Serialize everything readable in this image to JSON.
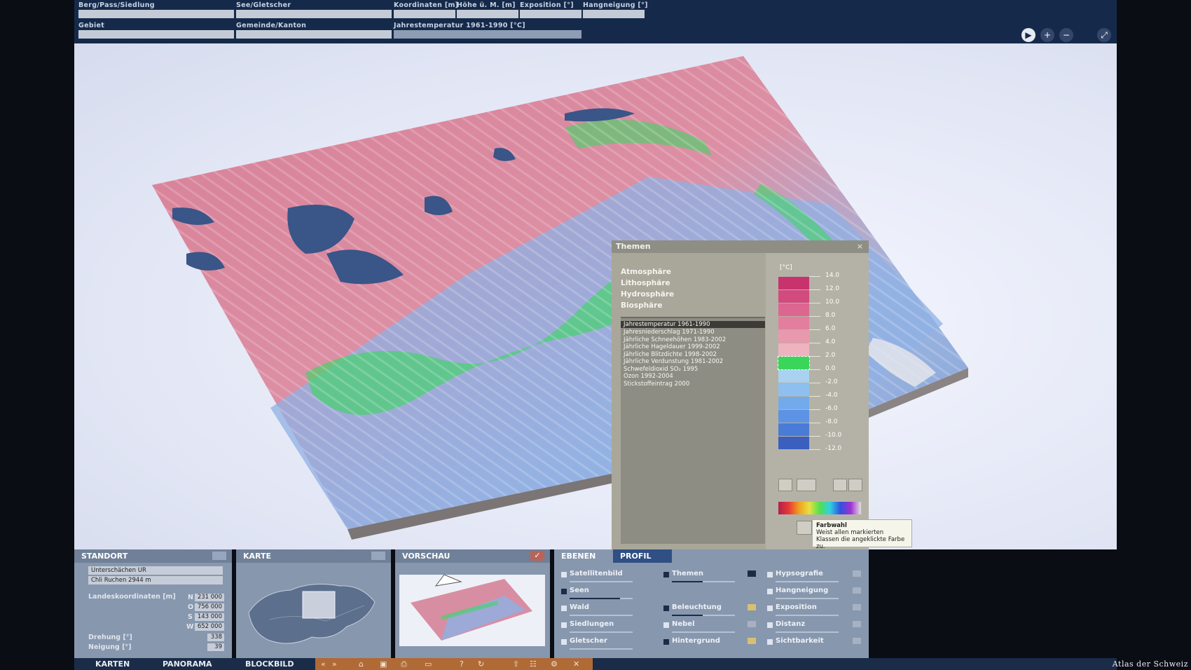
{
  "topbar": {
    "row1": [
      "Berg/Pass/Siedlung",
      "See/Gletscher",
      "Koordinaten [m]",
      "Höhe ü. M. [m]",
      "Exposition [°]",
      "Hangneigung [°]"
    ],
    "row2": [
      "Gebiet",
      "Gemeinde/Kanton",
      "Jahrestemperatur 1961-1990 [°C]"
    ],
    "controls": [
      "play-icon",
      "zoom-in-icon",
      "zoom-out-icon",
      "fullscreen-icon"
    ]
  },
  "themen": {
    "title": "Themen",
    "close": "×",
    "categories": [
      "Atmosphäre",
      "Lithosphäre",
      "Hydrosphäre",
      "Biosphäre"
    ],
    "items": [
      "Jahrestemperatur 1961-1990",
      "Jahresniederschlag 1971-1990",
      "Jährliche Schneehöhen 1983-2002",
      "Jährliche Hageldauer 1999-2002",
      "Jährliche Blitzdichte 1998-2002",
      "Jährliche Verdunstung 1981-2002",
      "Schwefeldioxid SO₂ 1995",
      "Ozon 1992-2004",
      "Stickstoffeintrag 2000"
    ],
    "selected_index": 0,
    "legend": {
      "unit": "[°C]",
      "ticks": [
        "14.0",
        "12.0",
        "10.0",
        "8.0",
        "6.0",
        "4.0",
        "2.0",
        "0.0",
        "-2.0",
        "-4.0",
        "-6.0",
        "-8.0",
        "-10.0",
        "-12.0"
      ],
      "colors": [
        "#c8336e",
        "#d24a7e",
        "#dc6690",
        "#e27f9f",
        "#e899ae",
        "#eeb3bf",
        "#3ad65a",
        "#a8d2f0",
        "#8ec0ef",
        "#73aaeb",
        "#5d93e4",
        "#4a7bd6",
        "#3a5fbf"
      ]
    },
    "tooltip": {
      "title": "Farbwahl",
      "text": "Weist allen markierten Klassen die angeklickte Farbe zu."
    }
  },
  "standort": {
    "title": "STANDORT",
    "place": "Unterschächen  UR",
    "peak": "Chli Ruchen  2944 m",
    "coords_label": "Landeskoordinaten [m]",
    "coords": [
      {
        "dir": "N",
        "value": "231 000"
      },
      {
        "dir": "O",
        "value": "756 000"
      },
      {
        "dir": "S",
        "value": "143 000"
      },
      {
        "dir": "W",
        "value": "652 000"
      }
    ],
    "drehung_label": "Drehung [°]",
    "drehung": "338",
    "neigung_label": "Neigung [°]",
    "neigung": "39"
  },
  "karte": {
    "title": "KARTE"
  },
  "vorschau": {
    "title": "VORSCHAU"
  },
  "ebenen": {
    "tab1": "EBENEN",
    "tab2": "PROFIL",
    "col1": [
      {
        "label": "Satellitenbild",
        "checked": false
      },
      {
        "label": "Seen",
        "checked": true
      },
      {
        "label": "Wald",
        "checked": false
      },
      {
        "label": "Siedlungen",
        "checked": false
      },
      {
        "label": "Gletscher",
        "checked": false
      }
    ],
    "col2": [
      {
        "label": "Themen",
        "checked": true
      },
      {
        "label": "Beleuchtung",
        "checked": true
      },
      {
        "label": "Nebel",
        "checked": false
      },
      {
        "label": "Hintergrund",
        "checked": true
      }
    ],
    "col3": [
      {
        "label": "Hypsografie",
        "checked": false
      },
      {
        "label": "Hangneigung",
        "checked": false
      },
      {
        "label": "Exposition",
        "checked": false
      },
      {
        "label": "Distanz",
        "checked": false
      },
      {
        "label": "Sichtbarkeit",
        "checked": false
      }
    ]
  },
  "nav": {
    "items": [
      "KARTEN",
      "PANORAMA",
      "BLOCKBILD"
    ],
    "active": "BLOCKBILD",
    "tools": [
      "«",
      "»",
      "⌂",
      "▣",
      "⎙",
      "▭",
      "?",
      "↻",
      "⇧",
      "☷",
      "⚙",
      "✕"
    ],
    "brand": "Atlas der Schweiz"
  }
}
